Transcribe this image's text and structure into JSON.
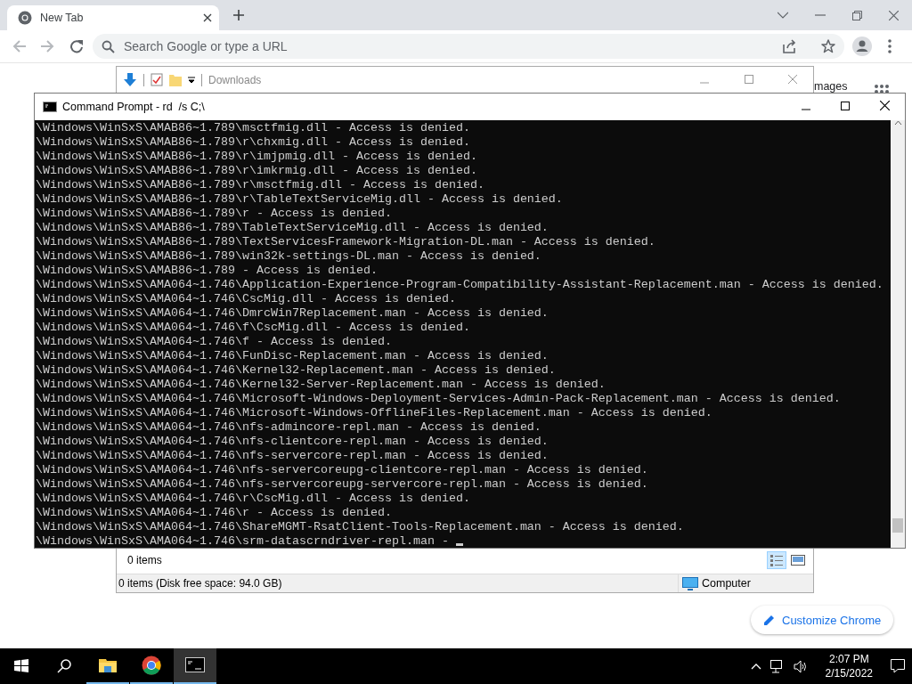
{
  "browser": {
    "tab": {
      "title": "New Tab"
    },
    "omnibox": {
      "placeholder": "Search Google or type a URL"
    },
    "images_link": "mages",
    "customize_button": "Customize Chrome"
  },
  "explorer": {
    "title": "Downloads",
    "items_label": "0 items",
    "status": "0 items (Disk free space: 94.0 GB)",
    "location": "Computer",
    "views": [
      {
        "kind": "details",
        "selected": true
      },
      {
        "kind": "preview",
        "selected": false
      }
    ]
  },
  "cmd": {
    "title": "Command Prompt - rd  /s C;\\",
    "lines": [
      "\\Windows\\WinSxS\\AMAB86~1.789\\msctfmig.dll - Access is denied.",
      "\\Windows\\WinSxS\\AMAB86~1.789\\r\\chxmig.dll - Access is denied.",
      "\\Windows\\WinSxS\\AMAB86~1.789\\r\\imjpmig.dll - Access is denied.",
      "\\Windows\\WinSxS\\AMAB86~1.789\\r\\imkrmig.dll - Access is denied.",
      "\\Windows\\WinSxS\\AMAB86~1.789\\r\\msctfmig.dll - Access is denied.",
      "\\Windows\\WinSxS\\AMAB86~1.789\\r\\TableTextServiceMig.dll - Access is denied.",
      "\\Windows\\WinSxS\\AMAB86~1.789\\r - Access is denied.",
      "\\Windows\\WinSxS\\AMAB86~1.789\\TableTextServiceMig.dll - Access is denied.",
      "\\Windows\\WinSxS\\AMAB86~1.789\\TextServicesFramework-Migration-DL.man - Access is denied.",
      "\\Windows\\WinSxS\\AMAB86~1.789\\win32k-settings-DL.man - Access is denied.",
      "\\Windows\\WinSxS\\AMAB86~1.789 - Access is denied.",
      "\\Windows\\WinSxS\\AMA064~1.746\\Application-Experience-Program-Compatibility-Assistant-Replacement.man - Access is denied.",
      "\\Windows\\WinSxS\\AMA064~1.746\\CscMig.dll - Access is denied.",
      "\\Windows\\WinSxS\\AMA064~1.746\\DmrcWin7Replacement.man - Access is denied.",
      "\\Windows\\WinSxS\\AMA064~1.746\\f\\CscMig.dll - Access is denied.",
      "\\Windows\\WinSxS\\AMA064~1.746\\f - Access is denied.",
      "\\Windows\\WinSxS\\AMA064~1.746\\FunDisc-Replacement.man - Access is denied.",
      "\\Windows\\WinSxS\\AMA064~1.746\\Kernel32-Replacement.man - Access is denied.",
      "\\Windows\\WinSxS\\AMA064~1.746\\Kernel32-Server-Replacement.man - Access is denied.",
      "\\Windows\\WinSxS\\AMA064~1.746\\Microsoft-Windows-Deployment-Services-Admin-Pack-Replacement.man - Access is denied.",
      "\\Windows\\WinSxS\\AMA064~1.746\\Microsoft-Windows-OfflineFiles-Replacement.man - Access is denied.",
      "\\Windows\\WinSxS\\AMA064~1.746\\nfs-admincore-repl.man - Access is denied.",
      "\\Windows\\WinSxS\\AMA064~1.746\\nfs-clientcore-repl.man - Access is denied.",
      "\\Windows\\WinSxS\\AMA064~1.746\\nfs-servercore-repl.man - Access is denied.",
      "\\Windows\\WinSxS\\AMA064~1.746\\nfs-servercoreupg-clientcore-repl.man - Access is denied.",
      "\\Windows\\WinSxS\\AMA064~1.746\\nfs-servercoreupg-servercore-repl.man - Access is denied.",
      "\\Windows\\WinSxS\\AMA064~1.746\\r\\CscMig.dll - Access is denied.",
      "\\Windows\\WinSxS\\AMA064~1.746\\r - Access is denied.",
      "\\Windows\\WinSxS\\AMA064~1.746\\ShareMGMT-RsatClient-Tools-Replacement.man - Access is denied.",
      "\\Windows\\WinSxS\\AMA064~1.746\\srm-datascrndriver-repl.man -"
    ]
  },
  "taskbar": {
    "apps": [
      {
        "kind": "explorer",
        "active": false
      },
      {
        "kind": "chrome",
        "active": false
      },
      {
        "kind": "terminal",
        "active": true
      }
    ],
    "time": "2:07 PM",
    "date": "2/15/2022"
  }
}
